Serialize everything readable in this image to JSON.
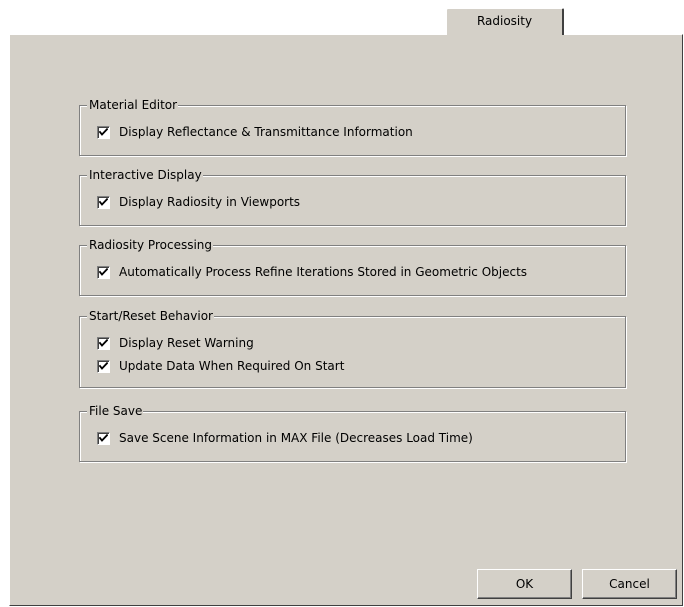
{
  "tab": {
    "label": "Radiosity"
  },
  "groups": [
    {
      "title": "Material Editor",
      "items": [
        {
          "label": "Display Reflectance & Transmittance Information",
          "checked": true
        }
      ]
    },
    {
      "title": "Interactive Display",
      "items": [
        {
          "label": "Display Radiosity in Viewports",
          "checked": true
        }
      ]
    },
    {
      "title": "Radiosity Processing",
      "items": [
        {
          "label": "Automatically Process Refine Iterations Stored in Geometric Objects",
          "checked": true
        }
      ]
    },
    {
      "title": "Start/Reset Behavior",
      "items": [
        {
          "label": "Display Reset Warning",
          "checked": true
        },
        {
          "label": "Update Data When Required On Start",
          "checked": true
        }
      ]
    },
    {
      "title": "File Save",
      "items": [
        {
          "label": "Save Scene Information in MAX File (Decreases Load Time)",
          "checked": true
        }
      ]
    }
  ],
  "buttons": {
    "ok_label": "OK",
    "cancel_label": "Cancel"
  },
  "colors": {
    "face": "#d4d0c8",
    "shadow": "#808080",
    "highlight": "#ffffff",
    "dark_shadow": "#404040"
  },
  "icons": {
    "checkmark": "checkmark-icon"
  }
}
